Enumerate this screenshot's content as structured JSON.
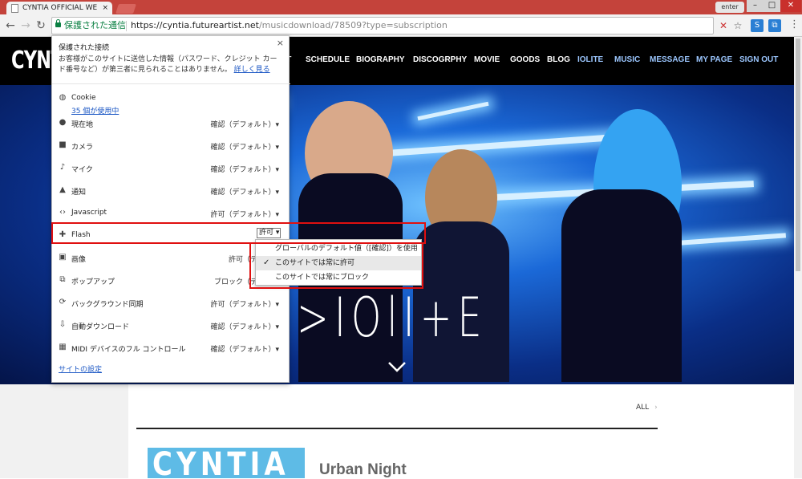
{
  "browser": {
    "tab_title": "CYNTIA OFFICIAL WE",
    "tab_close": "×",
    "user": "enter",
    "win_min": "–",
    "win_max": "□",
    "win_close": "✕",
    "secure_label": "保護された通信",
    "url_host": "https://cyntia.futureartist.net",
    "url_path": "/musicdownload/78509?type=subscription",
    "back": "←",
    "forward": "→",
    "reload": "↻",
    "star": "☆",
    "menu": "⋮"
  },
  "site": {
    "logo": "CYNTIA",
    "nav": [
      {
        "label": "NT",
        "color": "#ffffff"
      },
      {
        "label": "SCHEDULE",
        "color": "#ffffff"
      },
      {
        "label": "BIOGRAPHY",
        "color": "#ffffff"
      },
      {
        "label": "DISCOGRPHY",
        "color": "#ffffff"
      },
      {
        "label": "MOVIE",
        "color": "#ffffff"
      },
      {
        "label": "GOODS",
        "color": "#ffffff"
      },
      {
        "label": "BLOG",
        "color": "#ffffff"
      },
      {
        "label": "IOLITE",
        "color": "#9cc7ff"
      },
      {
        "label": "MUSIC",
        "color": "#9cc7ff"
      },
      {
        "label": "MESSAGE",
        "color": "#9cc7ff"
      },
      {
        "label": "MY PAGE",
        "color": "#9cc7ff"
      },
      {
        "label": "SIGN OUT",
        "color": "#9cc7ff"
      }
    ],
    "hero_text": ">IOlI+E",
    "all_link": "ALL",
    "all_arrow": "›",
    "album_logo": "CYNTIA",
    "album_title": "Urban Night"
  },
  "popup": {
    "close": "×",
    "title": "保護された接続",
    "desc": "お客様がこのサイトに送信した情報（パスワード、クレジット カード番号など）が第三者に見られることはありません。",
    "more_link": "詳しく見る",
    "cookie_label": "Cookie",
    "cookie_sub": "35 個が使用中",
    "rows": [
      {
        "icon": "location-icon",
        "glyph": "●",
        "label": "現在地",
        "value": "確認（デフォルト）▾"
      },
      {
        "icon": "camera-icon",
        "glyph": "■",
        "label": "カメラ",
        "value": "確認（デフォルト）▾"
      },
      {
        "icon": "mic-icon",
        "glyph": "♪",
        "label": "マイク",
        "value": "確認（デフォルト）▾"
      },
      {
        "icon": "bell-icon",
        "glyph": "▲",
        "label": "通知",
        "value": "確認（デフォルト）▾"
      },
      {
        "icon": "code-icon",
        "glyph": "‹›",
        "label": "Javascript",
        "value": "許可（デフォルト）▾"
      },
      {
        "icon": "puzzle-icon",
        "glyph": "✚",
        "label": "Flash",
        "value": ""
      },
      {
        "icon": "image-icon",
        "glyph": "▣",
        "label": "画像",
        "value": "許可（デフォル"
      },
      {
        "icon": "popup-icon",
        "glyph": "⧉",
        "label": "ポップアップ",
        "value": "ブロック（デフォル"
      },
      {
        "icon": "sync-icon",
        "glyph": "⟳",
        "label": "バックグラウンド同期",
        "value": "許可（デフォルト）▾"
      },
      {
        "icon": "download-icon",
        "glyph": "⇩",
        "label": "自動ダウンロード",
        "value": "確認（デフォルト）▾"
      },
      {
        "icon": "midi-icon",
        "glyph": "▦",
        "label": "MIDI デバイスのフル コントロール",
        "value": "確認（デフォルト）▾"
      }
    ],
    "flash_select": "許可 ▾",
    "site_settings": "サイトの設定",
    "dropdown": [
      {
        "label": "グローバルのデフォルト値（[確認]）を使用",
        "selected": false
      },
      {
        "label": "このサイトでは常に許可",
        "selected": true
      },
      {
        "label": "このサイトでは常にブロック",
        "selected": false
      }
    ],
    "check": "✓"
  }
}
